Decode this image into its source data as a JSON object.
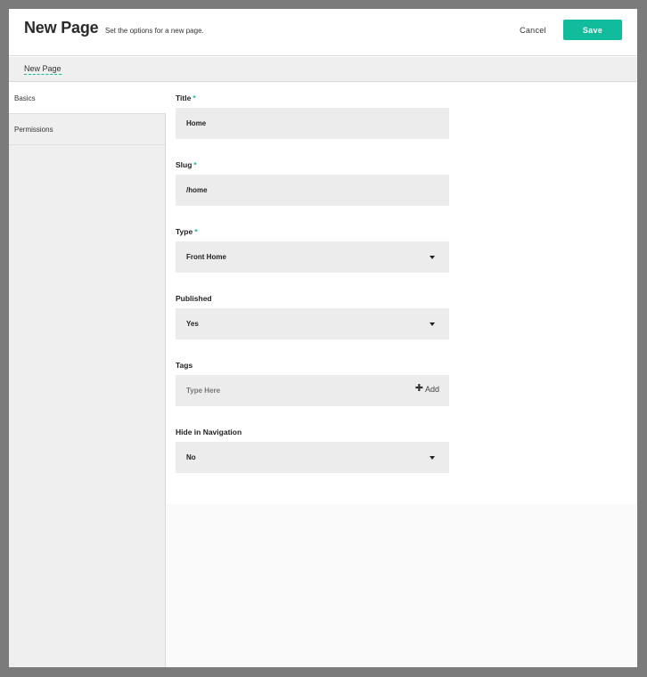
{
  "header": {
    "title": "New Page",
    "subtitle": "Set the options for a new page.",
    "cancel_label": "Cancel",
    "save_label": "Save"
  },
  "breadcrumb": {
    "current": "New Page"
  },
  "sidebar": {
    "items": [
      {
        "label": "Basics",
        "active": true
      },
      {
        "label": "Permissions",
        "active": false
      }
    ]
  },
  "form": {
    "title": {
      "label": "Title",
      "required_mark": "*",
      "value": "Home"
    },
    "slug": {
      "label": "Slug",
      "required_mark": "*",
      "value": "/home"
    },
    "type": {
      "label": "Type",
      "required_mark": "*",
      "value": "Front Home"
    },
    "published": {
      "label": "Published",
      "value": "Yes"
    },
    "tags": {
      "label": "Tags",
      "placeholder": "Type Here",
      "add_label": "Add"
    },
    "hide_in_navigation": {
      "label": "Hide in Navigation",
      "value": "No"
    }
  },
  "colors": {
    "accent": "#10bc9b",
    "backdrop": "#7b7b7b",
    "field_bg": "#ececec",
    "sidebar_bg": "#efefef"
  },
  "icons": {
    "dropdown": "caret-down-icon",
    "add": "plus-icon"
  }
}
